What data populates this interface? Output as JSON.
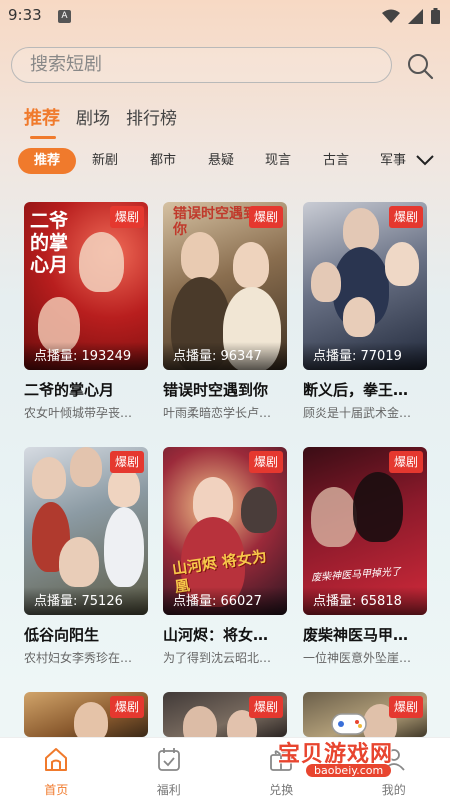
{
  "status_bar": {
    "time": "9:33",
    "notif_icon": "A"
  },
  "search": {
    "placeholder": "搜索短剧"
  },
  "tabs": [
    {
      "label": "推荐",
      "active": true
    },
    {
      "label": "剧场",
      "active": false
    },
    {
      "label": "排行榜",
      "active": false
    }
  ],
  "categories": [
    "推荐",
    "新剧",
    "都市",
    "悬疑",
    "现言",
    "古言",
    "军事"
  ],
  "dramas": [
    {
      "title": "二爷的掌心月",
      "desc": "农女叶倾城带孕丧…",
      "plays_label": "点播量: 193249",
      "badge": "爆剧",
      "poster_text": "二爷的掌心月"
    },
    {
      "title": "错误时空遇到你",
      "desc": "叶雨柔暗恋学长卢…",
      "plays_label": "点播量: 96347",
      "badge": "爆剧",
      "poster_text": "错误时空遇到你"
    },
    {
      "title": "断义后，拳王…",
      "desc": "顾炎是十届武术金…",
      "plays_label": "点播量: 77019",
      "badge": "爆剧",
      "poster_text": ""
    },
    {
      "title": "低谷向阳生",
      "desc": "农村妇女李秀珍在…",
      "plays_label": "点播量: 75126",
      "badge": "爆剧",
      "poster_text": ""
    },
    {
      "title": "山河烬：将女…",
      "desc": "为了得到沈云昭北…",
      "plays_label": "点播量: 66027",
      "badge": "爆剧",
      "poster_text": "山河烬 将女为凰"
    },
    {
      "title": "废柴神医马甲…",
      "desc": "一位神医意外坠崖…",
      "plays_label": "点播量: 65818",
      "badge": "爆剧",
      "poster_text": "废柴神医马甲掉光了"
    },
    {
      "title": "",
      "desc": "",
      "plays_label": "",
      "badge": "爆剧",
      "poster_text": ""
    },
    {
      "title": "",
      "desc": "",
      "plays_label": "",
      "badge": "爆剧",
      "poster_text": ""
    },
    {
      "title": "",
      "desc": "",
      "plays_label": "",
      "badge": "爆剧",
      "poster_text": ""
    }
  ],
  "bottom_nav": [
    {
      "label": "首页",
      "icon": "home-icon",
      "active": true
    },
    {
      "label": "福利",
      "icon": "calendar-icon",
      "active": false
    },
    {
      "label": "兑换",
      "icon": "gift-icon",
      "active": false
    },
    {
      "label": "我的",
      "icon": "user-icon",
      "active": false
    }
  ],
  "watermark": {
    "title": "宝贝游戏网",
    "url": "baobeiy.com"
  },
  "colors": {
    "accent": "#f07a2c",
    "badge": "#e5382f"
  }
}
